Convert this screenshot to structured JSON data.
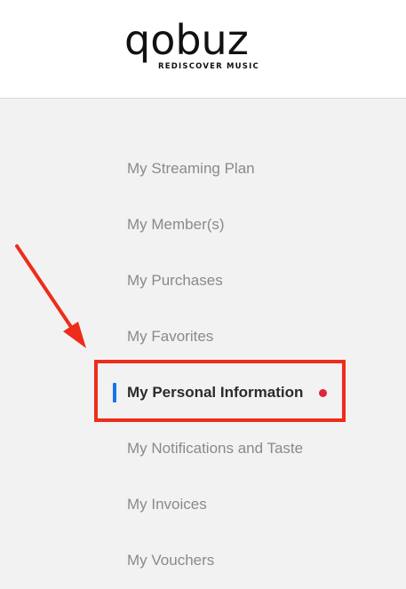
{
  "brand": {
    "name": "qobuz",
    "tagline": "REDISCOVER MUSIC"
  },
  "menu": {
    "items": [
      {
        "label": "My Streaming Plan"
      },
      {
        "label": "My Member(s)"
      },
      {
        "label": "My Purchases"
      },
      {
        "label": "My Favorites"
      },
      {
        "label": "My Personal Information"
      },
      {
        "label": "My Notifications and Taste"
      },
      {
        "label": "My Invoices"
      },
      {
        "label": "My Vouchers"
      }
    ],
    "active_index": 4
  },
  "colors": {
    "active_indicator": "#1a73e8",
    "notification_dot": "#e0243c",
    "annotation": "#ee2c1b"
  },
  "icons": {
    "notification": "notification-dot-icon",
    "annotation": "red-arrow-annotation"
  }
}
